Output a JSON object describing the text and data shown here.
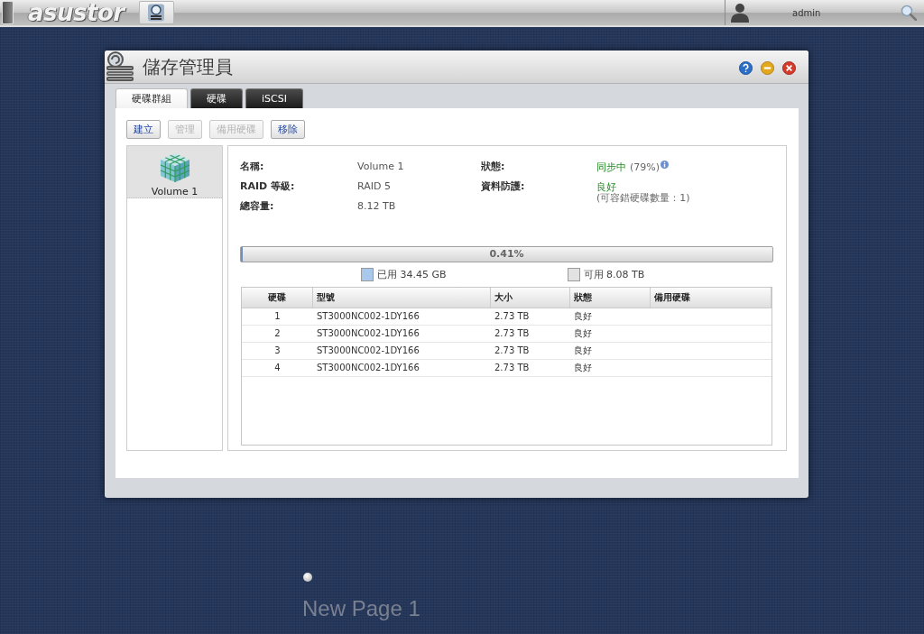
{
  "top_bar": {
    "logo": "asustor",
    "user": "admin"
  },
  "window": {
    "title": "儲存管理員"
  },
  "tabs": [
    {
      "label": "硬碟群組",
      "selected": true
    },
    {
      "label": "硬碟",
      "selected": false
    },
    {
      "label": "iSCSI",
      "selected": false
    }
  ],
  "toolbar": [
    {
      "label": "建立",
      "disabled": false
    },
    {
      "label": "管理",
      "disabled": true
    },
    {
      "label": "備用硬碟",
      "disabled": true
    },
    {
      "label": "移除",
      "disabled": false
    }
  ],
  "volumes": [
    {
      "label": "Volume 1",
      "selected": true
    }
  ],
  "details": {
    "fields": [
      {
        "label": "名稱:",
        "value": "Volume 1"
      },
      {
        "label": "RAID 等級:",
        "value": "RAID 5"
      },
      {
        "label": "總容量:",
        "value": "8.12 TB"
      }
    ],
    "status_fields": [
      {
        "label": "狀態:",
        "status": "同步中",
        "detail": "(79%)",
        "info_icon": true
      },
      {
        "label": "資料防護:",
        "status": "良好",
        "note": "(可容錯硬碟數量：1)"
      }
    ]
  },
  "usage": {
    "label": "0.41%",
    "level": 0.0041,
    "legend": [
      {
        "label": "已用 34.45 GB",
        "color": "#a8c8ec"
      },
      {
        "label": "可用 8.08 TB",
        "color": "#e2e2e2"
      }
    ]
  },
  "disk_table": {
    "columns": [
      "硬碟",
      "型號",
      "大小",
      "狀態",
      "備用硬碟"
    ],
    "rows": [
      [
        "1",
        "ST3000NC002-1DY166",
        "2.73 TB",
        "良好"
      ],
      [
        "2",
        "ST3000NC002-1DY166",
        "2.73 TB",
        "良好"
      ],
      [
        "3",
        "ST3000NC002-1DY166",
        "2.73 TB",
        "良好"
      ],
      [
        "4",
        "ST3000NC002-1DY166",
        "2.73 TB",
        "良好"
      ]
    ]
  },
  "desktop": {
    "page_label": "New Page 1"
  }
}
